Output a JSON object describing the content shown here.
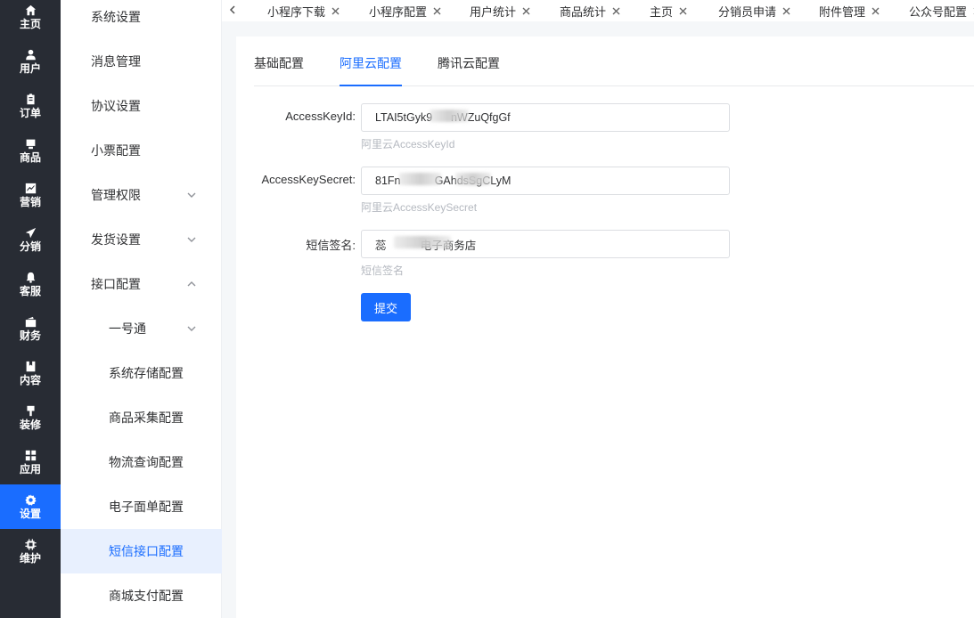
{
  "rail": [
    {
      "label": "主页",
      "icon": "home-icon"
    },
    {
      "label": "用户",
      "icon": "user-icon"
    },
    {
      "label": "订单",
      "icon": "order-icon"
    },
    {
      "label": "商品",
      "icon": "product-icon"
    },
    {
      "label": "营销",
      "icon": "chart-icon"
    },
    {
      "label": "分销",
      "icon": "send-icon"
    },
    {
      "label": "客服",
      "icon": "bell-icon"
    },
    {
      "label": "财务",
      "icon": "wallet-icon"
    },
    {
      "label": "内容",
      "icon": "book-icon"
    },
    {
      "label": "装修",
      "icon": "brush-icon"
    },
    {
      "label": "应用",
      "icon": "grid-icon"
    },
    {
      "label": "设置",
      "icon": "gear-icon"
    },
    {
      "label": "维护",
      "icon": "chip-icon"
    }
  ],
  "submenu": [
    {
      "label": "系统设置"
    },
    {
      "label": "消息管理"
    },
    {
      "label": "协议设置"
    },
    {
      "label": "小票配置"
    },
    {
      "label": "管理权限"
    },
    {
      "label": "发货设置"
    },
    {
      "label": "接口配置"
    },
    {
      "label": "一号通"
    },
    {
      "label": "系统存储配置"
    },
    {
      "label": "商品采集配置"
    },
    {
      "label": "物流查询配置"
    },
    {
      "label": "电子面单配置"
    },
    {
      "label": "短信接口配置"
    },
    {
      "label": "商城支付配置"
    }
  ],
  "tabs": [
    {
      "label": "小程序下载"
    },
    {
      "label": "小程序配置"
    },
    {
      "label": "用户统计"
    },
    {
      "label": "商品统计"
    },
    {
      "label": "主页"
    },
    {
      "label": "分销员申请"
    },
    {
      "label": "附件管理"
    },
    {
      "label": "公众号配置"
    }
  ],
  "config_tabs": [
    {
      "label": "基础配置"
    },
    {
      "label": "阿里云配置"
    },
    {
      "label": "腾讯云配置"
    }
  ],
  "form": {
    "access_key_id": {
      "label": "AccessKeyId:",
      "value": "LTAI5tGyk9      nWZuQfgGf",
      "hint": "阿里云AccessKeyId"
    },
    "access_key_secret": {
      "label": "AccessKeySecret:",
      "value": "81Fn           GAhdsSgCLyM",
      "hint": "阿里云AccessKeySecret"
    },
    "sms_sign": {
      "label": "短信签名:",
      "value": "蕊           电子商务店",
      "hint": "短信签名"
    },
    "submit_label": "提交"
  },
  "colors": {
    "accent": "#1a6dff",
    "rail_bg": "#282c34",
    "active_menu_bg": "#e8f0fe"
  }
}
